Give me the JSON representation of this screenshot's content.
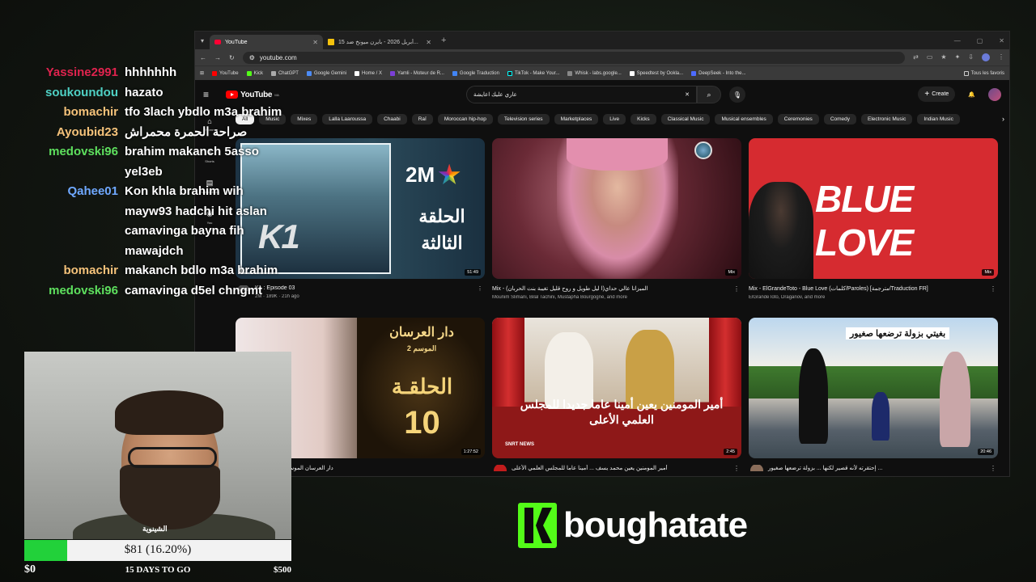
{
  "browser": {
    "tabs": [
      {
        "title": "YouTube",
        "active": true
      },
      {
        "title": "15 أبريل 2026 - بايرن ميونخ ضد..."
      }
    ],
    "url": "youtube.com",
    "bookmarks": [
      "YouTube",
      "Kick",
      "ChatGPT",
      "Google Gemini",
      "Home / X",
      "Yamli - Moteur de R...",
      "Google Traduction",
      "TikTok - Make Your...",
      "Whisk - labs.google...",
      "Speedtest by Ookla...",
      "DeepSeek - Into the..."
    ],
    "bookmarks_right": "Tous les favoris"
  },
  "youtube": {
    "logo": "YouTube",
    "region": "MA",
    "search_query": "عاري عليك اعايشة",
    "create_label": "Create",
    "guide": [
      {
        "icon": "⌂",
        "label": "Home"
      },
      {
        "icon": "↯",
        "label": "Shorts"
      },
      {
        "icon": "▤",
        "label": "Subscriptions"
      },
      {
        "icon": "◉",
        "label": "You"
      }
    ],
    "chips": [
      "All",
      "Music",
      "Mixes",
      "Lalla Laaroussa",
      "Chaabi",
      "Raï",
      "Moroccan hip-hop",
      "Television series",
      "Marketplaces",
      "Live",
      "Kicks",
      "Classical Music",
      "Musical ensembles",
      "Ceremonies",
      "Comedy",
      "Electronic Music",
      "Indian Music"
    ],
    "videos": [
      {
        "title": "K1 : Episode 03",
        "meta": "2M · 189K · 21h ago",
        "duration": "51:49",
        "thumb_text_1": "K1",
        "thumb_text_2": "2M",
        "thumb_text_3": "الحلقة الثالثة"
      },
      {
        "title": "Mix - الميزانا عالي حداي(ا ليل طويل و روح قليل تغيبة بنت الحربان)",
        "meta": "Mounim Slimani, Bilal Tachini, Mustapha Bourgogne, and more",
        "duration": "Mix"
      },
      {
        "title": "Mix - ElGrandeToto - Blue Love (كلمات/Paroles) [مترجمة/Traduction FR]",
        "meta": "ElGrandeToto, Draganov, and more",
        "duration": "Mix",
        "thumb_text_1": "BLUE LOVE"
      },
      {
        "title": "دار العرسان الموسم 2 | الحلقة 10 (2026)",
        "meta": "",
        "duration": "1:27:52",
        "thumb_text_1": "دار العرسان",
        "thumb_text_2": "الموسم 2",
        "thumb_text_3": "الحلقـة",
        "thumb_text_4": "10"
      },
      {
        "title": "أمير المومنين يعين محمد يسف ... أمينا عاما للمجلس العلمي الأعلى",
        "meta": "",
        "duration": "2:45",
        "thumb_text_1": "أمير المومنين يعين أمينا عاما جديدا للمجلس العلمي الأعلى",
        "thumb_text_2": "SNRT NEWS"
      },
      {
        "title": "إحتقرته لأنه قصير لكنها ... بزولة ترضعها صغيور ...",
        "meta": "",
        "duration": "20:46",
        "thumb_text_1": "بغيتي بزولة ترضعها صغيور"
      }
    ]
  },
  "chat": [
    {
      "user": "Yassine2991",
      "color": "#e0234e",
      "text": "hhhhhhh"
    },
    {
      "user": "soukoundou",
      "color": "#4fd1c5",
      "text": "hazato"
    },
    {
      "user": "bomachir",
      "color": "#f5c27a",
      "text": "tfo 3lach ybdlo m3a brahim"
    },
    {
      "user": "Ayoubid23",
      "color": "#f5c27a",
      "text": "صراحة الحمرة محمراش"
    },
    {
      "user": "medovski96",
      "color": "#5ee05e",
      "text": "brahim makanch 5asso yel3eb"
    },
    {
      "user": "Qahee01",
      "color": "#6fa8ff",
      "text": "Kon khla brahim wih mayw93 hadchi hit aslan camavinga bayna fih mawajdch"
    },
    {
      "user": "bomachir",
      "color": "#f5c27a",
      "text": "makanch bdlo m3a brahim"
    },
    {
      "user": "medovski96",
      "color": "#5ee05e",
      "text": "camavinga d5el chngmt"
    }
  ],
  "webcam": {
    "name_overlay": "الشينوية"
  },
  "goal": {
    "text": "$81 (16.20%)",
    "progress": 0.162,
    "start": "$0",
    "middle": "15 DAYS TO GO",
    "end": "$500",
    "fill_color": "#22d13a"
  },
  "branding": {
    "name": "boughatate",
    "accent": "#53fc18"
  }
}
